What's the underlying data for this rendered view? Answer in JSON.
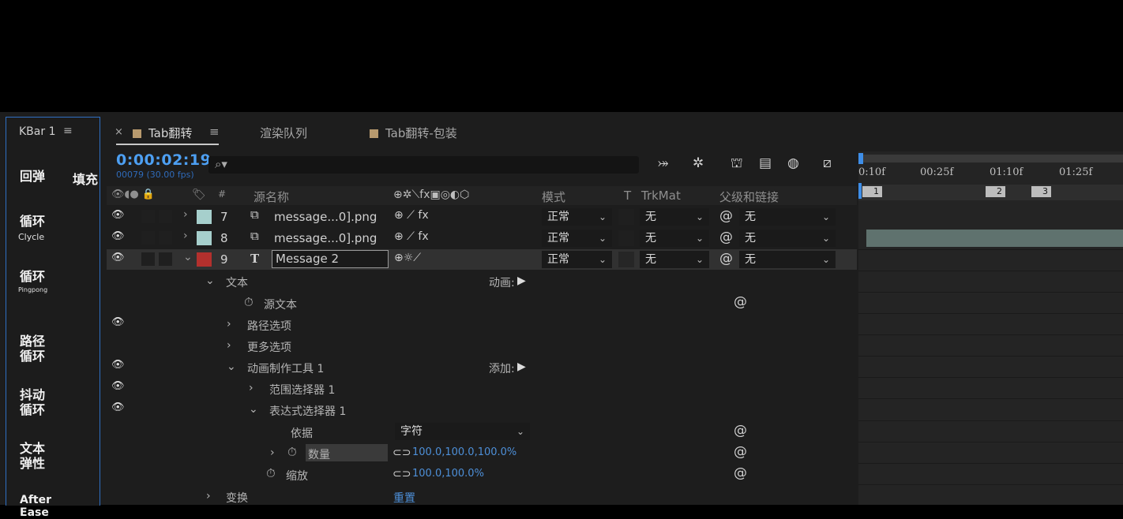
{
  "kbar": {
    "title": "KBar 1",
    "menu_icon": "≡",
    "buttons": [
      {
        "main": "回弹",
        "sub": ""
      },
      {
        "main": "循环",
        "sub": "Clycle"
      },
      {
        "main": "循环",
        "sub": "Pingpong"
      },
      {
        "main": "路径\n循环",
        "sub": ""
      },
      {
        "main": "抖动\n循环",
        "sub": ""
      },
      {
        "main": "文本\n弹性",
        "sub": ""
      },
      {
        "main": "After\nEase",
        "sub": ""
      }
    ],
    "extra": "填充"
  },
  "tabs": {
    "close": "×",
    "comp1": "Tab翻转",
    "menu": "≡",
    "render": "渲染队列",
    "comp2": "Tab翻转-包装"
  },
  "time": {
    "timecode": "0:00:02:19",
    "frames": "00079 (30.00 fps)"
  },
  "search": {
    "icon": "⌕▾"
  },
  "columns": {
    "av_icons": "👁◖● 🔒",
    "label_icon": "🏷",
    "hash": "#",
    "source_name": "源名称",
    "switches": "⊕✲⟍fx▣◎◐⬡",
    "mode": "模式",
    "t": "T",
    "trkmat": "TrkMat",
    "parent": "父级和链接"
  },
  "layers": [
    {
      "num": "7",
      "name": "message...0].png",
      "type": "image",
      "label_color": "#a6cfcc",
      "switches": "⊕   ⟋ fx",
      "mode": "正常",
      "trkmat": "无",
      "parent": "无"
    },
    {
      "num": "8",
      "name": "message...0].png",
      "type": "image",
      "label_color": "#a6cfcc",
      "switches": "⊕   ⟋ fx",
      "mode": "正常",
      "trkmat": "无",
      "parent": "无"
    },
    {
      "num": "9",
      "name": "Message 2",
      "type": "text",
      "label_color": "#b3302d",
      "switches": "⊕☼⟋",
      "mode": "正常",
      "trkmat": "无",
      "parent": "无"
    }
  ],
  "props": {
    "text": "文本",
    "animate": "动画:",
    "source_text": "源文本",
    "path_options": "路径选项",
    "more_options": "更多选项",
    "animator": "动画制作工具 1",
    "add": "添加:",
    "range_selector": "范围选择器 1",
    "expression_selector": "表达式选择器 1",
    "based_on": "依据",
    "based_on_value": "字符",
    "amount": "数量",
    "amount_value": "100.0,100.0,100.0%",
    "scale": "缩放",
    "scale_value": "100.0,100.0%",
    "transform": "变换",
    "reset": "重置"
  },
  "timeline": {
    "ticks": [
      "0:10f",
      "00:25f",
      "01:10f",
      "01:25f"
    ],
    "markers": [
      "1",
      "2",
      "3"
    ]
  }
}
